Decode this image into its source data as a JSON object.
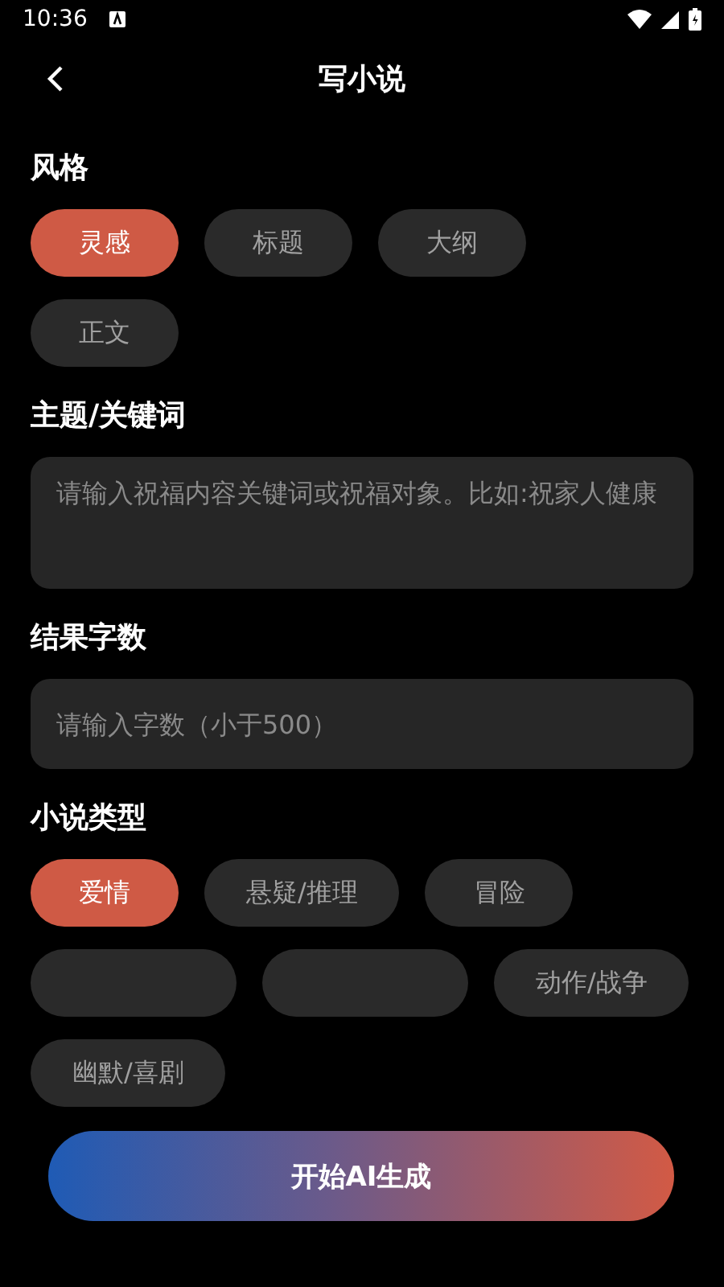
{
  "status_bar": {
    "time": "10:36"
  },
  "header": {
    "title": "写小说"
  },
  "style_section": {
    "heading": "风格",
    "options": [
      {
        "label": "灵感",
        "selected": true
      },
      {
        "label": "标题",
        "selected": false
      },
      {
        "label": "大纲",
        "selected": false
      },
      {
        "label": "正文",
        "selected": false
      }
    ]
  },
  "keyword_section": {
    "heading": "主题/关键词",
    "placeholder": "请输入祝福内容关键词或祝福对象。比如:祝家人健康"
  },
  "count_section": {
    "heading": "结果字数",
    "placeholder": "请输入字数（小于500）"
  },
  "genre_section": {
    "heading": "小说类型",
    "options": [
      {
        "label": "爱情",
        "selected": true
      },
      {
        "label": "悬疑/推理",
        "selected": false
      },
      {
        "label": "冒险",
        "selected": false
      },
      {
        "selected": false
      },
      {
        "selected": false
      },
      {
        "label": "动作/战争",
        "selected": false
      },
      {
        "label": "幽默/喜剧",
        "selected": false
      }
    ]
  },
  "generate_button": {
    "label": "开始AI生成"
  }
}
